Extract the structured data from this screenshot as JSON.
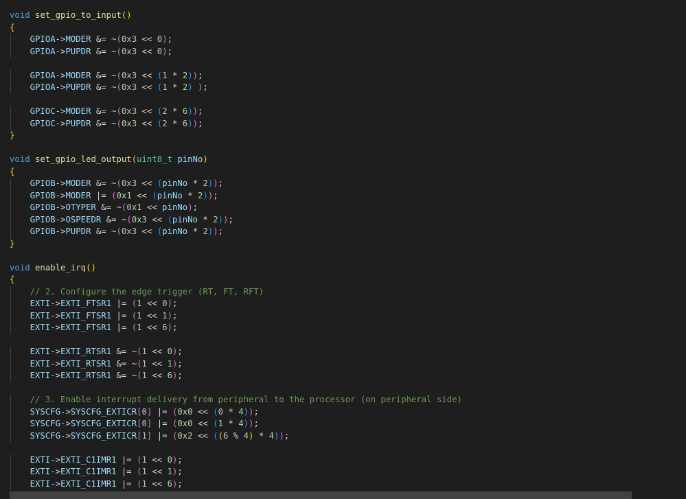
{
  "editor": {
    "lines": [
      [
        [
          "kw",
          "void"
        ],
        [
          "op",
          " "
        ],
        [
          "fn",
          "set_gpio_to_input"
        ],
        [
          "p1",
          "()"
        ]
      ],
      [
        [
          "p1",
          "{"
        ]
      ],
      [
        [
          "op",
          "    "
        ],
        [
          "var",
          "GPIOA"
        ],
        [
          "op",
          "->"
        ],
        [
          "var",
          "MODER"
        ],
        [
          "op",
          " &= ~"
        ],
        [
          "p2",
          "("
        ],
        [
          "num",
          "0x3"
        ],
        [
          "op",
          " << "
        ],
        [
          "num",
          "0"
        ],
        [
          "p2",
          ")"
        ],
        [
          "op",
          ";"
        ]
      ],
      [
        [
          "op",
          "    "
        ],
        [
          "var",
          "GPIOA"
        ],
        [
          "op",
          "->"
        ],
        [
          "var",
          "PUPDR"
        ],
        [
          "op",
          " &= ~"
        ],
        [
          "p2",
          "("
        ],
        [
          "num",
          "0x3"
        ],
        [
          "op",
          " << "
        ],
        [
          "num",
          "0"
        ],
        [
          "p2",
          ")"
        ],
        [
          "op",
          ";"
        ]
      ],
      [],
      [
        [
          "op",
          "    "
        ],
        [
          "var",
          "GPIOA"
        ],
        [
          "op",
          "->"
        ],
        [
          "var",
          "MODER"
        ],
        [
          "op",
          " &= ~"
        ],
        [
          "p2",
          "("
        ],
        [
          "num",
          "0x3"
        ],
        [
          "op",
          " << "
        ],
        [
          "p3",
          "("
        ],
        [
          "num",
          "1"
        ],
        [
          "op",
          " * "
        ],
        [
          "num",
          "2"
        ],
        [
          "p3",
          ")"
        ],
        [
          "p2",
          ")"
        ],
        [
          "op",
          ";"
        ]
      ],
      [
        [
          "op",
          "    "
        ],
        [
          "var",
          "GPIOA"
        ],
        [
          "op",
          "->"
        ],
        [
          "var",
          "PUPDR"
        ],
        [
          "op",
          " &= ~"
        ],
        [
          "p2",
          "("
        ],
        [
          "num",
          "0x3"
        ],
        [
          "op",
          " << "
        ],
        [
          "p3",
          "("
        ],
        [
          "num",
          "1"
        ],
        [
          "op",
          " * "
        ],
        [
          "num",
          "2"
        ],
        [
          "p3",
          ")"
        ],
        [
          "op",
          " "
        ],
        [
          "p2",
          ")"
        ],
        [
          "op",
          ";"
        ]
      ],
      [],
      [
        [
          "op",
          "    "
        ],
        [
          "var",
          "GPIOC"
        ],
        [
          "op",
          "->"
        ],
        [
          "var",
          "MODER"
        ],
        [
          "op",
          " &= ~"
        ],
        [
          "p2",
          "("
        ],
        [
          "num",
          "0x3"
        ],
        [
          "op",
          " << "
        ],
        [
          "p3",
          "("
        ],
        [
          "num",
          "2"
        ],
        [
          "op",
          " * "
        ],
        [
          "num",
          "6"
        ],
        [
          "p3",
          ")"
        ],
        [
          "p2",
          ")"
        ],
        [
          "op",
          ";"
        ]
      ],
      [
        [
          "op",
          "    "
        ],
        [
          "var",
          "GPIOC"
        ],
        [
          "op",
          "->"
        ],
        [
          "var",
          "PUPDR"
        ],
        [
          "op",
          " &= ~"
        ],
        [
          "p2",
          "("
        ],
        [
          "num",
          "0x3"
        ],
        [
          "op",
          " << "
        ],
        [
          "p3",
          "("
        ],
        [
          "num",
          "2"
        ],
        [
          "op",
          " * "
        ],
        [
          "num",
          "6"
        ],
        [
          "p3",
          ")"
        ],
        [
          "p2",
          ")"
        ],
        [
          "op",
          ";"
        ]
      ],
      [
        [
          "p1",
          "}"
        ]
      ],
      [],
      [
        [
          "kw",
          "void"
        ],
        [
          "op",
          " "
        ],
        [
          "fn",
          "set_gpio_led_output"
        ],
        [
          "p1",
          "("
        ],
        [
          "type",
          "uint8_t"
        ],
        [
          "op",
          " "
        ],
        [
          "var",
          "pinNo"
        ],
        [
          "p1",
          ")"
        ]
      ],
      [
        [
          "p1",
          "{"
        ]
      ],
      [
        [
          "op",
          "    "
        ],
        [
          "var",
          "GPIOB"
        ],
        [
          "op",
          "->"
        ],
        [
          "var",
          "MODER"
        ],
        [
          "op",
          " &= ~"
        ],
        [
          "p2",
          "("
        ],
        [
          "num",
          "0x3"
        ],
        [
          "op",
          " << "
        ],
        [
          "p3",
          "("
        ],
        [
          "var",
          "pinNo"
        ],
        [
          "op",
          " * "
        ],
        [
          "num",
          "2"
        ],
        [
          "p3",
          ")"
        ],
        [
          "p2",
          ")"
        ],
        [
          "op",
          ";"
        ]
      ],
      [
        [
          "op",
          "    "
        ],
        [
          "var",
          "GPIOB"
        ],
        [
          "op",
          "->"
        ],
        [
          "var",
          "MODER"
        ],
        [
          "op",
          " |= "
        ],
        [
          "p2",
          "("
        ],
        [
          "num",
          "0x1"
        ],
        [
          "op",
          " << "
        ],
        [
          "p3",
          "("
        ],
        [
          "var",
          "pinNo"
        ],
        [
          "op",
          " * "
        ],
        [
          "num",
          "2"
        ],
        [
          "p3",
          ")"
        ],
        [
          "p2",
          ")"
        ],
        [
          "op",
          ";"
        ]
      ],
      [
        [
          "op",
          "    "
        ],
        [
          "var",
          "GPIOB"
        ],
        [
          "op",
          "->"
        ],
        [
          "var",
          "OTYPER"
        ],
        [
          "op",
          " &= ~"
        ],
        [
          "p2",
          "("
        ],
        [
          "num",
          "0x1"
        ],
        [
          "op",
          " << "
        ],
        [
          "var",
          "pinNo"
        ],
        [
          "p2",
          ")"
        ],
        [
          "op",
          ";"
        ]
      ],
      [
        [
          "op",
          "    "
        ],
        [
          "var",
          "GPIOB"
        ],
        [
          "op",
          "->"
        ],
        [
          "var",
          "OSPEEDR"
        ],
        [
          "op",
          " &= ~"
        ],
        [
          "p2",
          "("
        ],
        [
          "num",
          "0x3"
        ],
        [
          "op",
          " << "
        ],
        [
          "p3",
          "("
        ],
        [
          "var",
          "pinNo"
        ],
        [
          "op",
          " * "
        ],
        [
          "num",
          "2"
        ],
        [
          "p3",
          ")"
        ],
        [
          "p2",
          ")"
        ],
        [
          "op",
          ";"
        ]
      ],
      [
        [
          "op",
          "    "
        ],
        [
          "var",
          "GPIOB"
        ],
        [
          "op",
          "->"
        ],
        [
          "var",
          "PUPDR"
        ],
        [
          "op",
          " &= ~"
        ],
        [
          "p2",
          "("
        ],
        [
          "num",
          "0x3"
        ],
        [
          "op",
          " << "
        ],
        [
          "p3",
          "("
        ],
        [
          "var",
          "pinNo"
        ],
        [
          "op",
          " * "
        ],
        [
          "num",
          "2"
        ],
        [
          "p3",
          ")"
        ],
        [
          "p2",
          ")"
        ],
        [
          "op",
          ";"
        ]
      ],
      [
        [
          "p1",
          "}"
        ]
      ],
      [],
      [
        [
          "kw",
          "void"
        ],
        [
          "op",
          " "
        ],
        [
          "fn",
          "enable_irq"
        ],
        [
          "p1",
          "()"
        ]
      ],
      [
        [
          "p1",
          "{"
        ]
      ],
      [
        [
          "op",
          "    "
        ],
        [
          "cm",
          "// 2. Configure the edge trigger (RT, FT, RFT)"
        ]
      ],
      [
        [
          "op",
          "    "
        ],
        [
          "var",
          "EXTI"
        ],
        [
          "op",
          "->"
        ],
        [
          "var",
          "EXTI_FTSR1"
        ],
        [
          "op",
          " |= "
        ],
        [
          "p2",
          "("
        ],
        [
          "num",
          "1"
        ],
        [
          "op",
          " << "
        ],
        [
          "num",
          "0"
        ],
        [
          "p2",
          ")"
        ],
        [
          "op",
          ";"
        ]
      ],
      [
        [
          "op",
          "    "
        ],
        [
          "var",
          "EXTI"
        ],
        [
          "op",
          "->"
        ],
        [
          "var",
          "EXTI_FTSR1"
        ],
        [
          "op",
          " |= "
        ],
        [
          "p2",
          "("
        ],
        [
          "num",
          "1"
        ],
        [
          "op",
          " << "
        ],
        [
          "num",
          "1"
        ],
        [
          "p2",
          ")"
        ],
        [
          "op",
          ";"
        ]
      ],
      [
        [
          "op",
          "    "
        ],
        [
          "var",
          "EXTI"
        ],
        [
          "op",
          "->"
        ],
        [
          "var",
          "EXTI_FTSR1"
        ],
        [
          "op",
          " |= "
        ],
        [
          "p2",
          "("
        ],
        [
          "num",
          "1"
        ],
        [
          "op",
          " << "
        ],
        [
          "num",
          "6"
        ],
        [
          "p2",
          ")"
        ],
        [
          "op",
          ";"
        ]
      ],
      [],
      [
        [
          "op",
          "    "
        ],
        [
          "var",
          "EXTI"
        ],
        [
          "op",
          "->"
        ],
        [
          "var",
          "EXTI_RTSR1"
        ],
        [
          "op",
          " &= ~"
        ],
        [
          "p2",
          "("
        ],
        [
          "num",
          "1"
        ],
        [
          "op",
          " << "
        ],
        [
          "num",
          "0"
        ],
        [
          "p2",
          ")"
        ],
        [
          "op",
          ";"
        ]
      ],
      [
        [
          "op",
          "    "
        ],
        [
          "var",
          "EXTI"
        ],
        [
          "op",
          "->"
        ],
        [
          "var",
          "EXTI_RTSR1"
        ],
        [
          "op",
          " &= ~"
        ],
        [
          "p2",
          "("
        ],
        [
          "num",
          "1"
        ],
        [
          "op",
          " << "
        ],
        [
          "num",
          "1"
        ],
        [
          "p2",
          ")"
        ],
        [
          "op",
          ";"
        ]
      ],
      [
        [
          "op",
          "    "
        ],
        [
          "var",
          "EXTI"
        ],
        [
          "op",
          "->"
        ],
        [
          "var",
          "EXTI_RTSR1"
        ],
        [
          "op",
          " &= ~"
        ],
        [
          "p2",
          "("
        ],
        [
          "num",
          "1"
        ],
        [
          "op",
          " << "
        ],
        [
          "num",
          "6"
        ],
        [
          "p2",
          ")"
        ],
        [
          "op",
          ";"
        ]
      ],
      [],
      [
        [
          "op",
          "    "
        ],
        [
          "cm",
          "// 3. Enable interrupt delivery from peripheral to the processor (on peripheral side)"
        ]
      ],
      [
        [
          "op",
          "    "
        ],
        [
          "var",
          "SYSCFG"
        ],
        [
          "op",
          "->"
        ],
        [
          "var",
          "SYSCFG_EXTICR"
        ],
        [
          "p2",
          "["
        ],
        [
          "num",
          "0"
        ],
        [
          "p2",
          "]"
        ],
        [
          "op",
          " |= "
        ],
        [
          "p2",
          "("
        ],
        [
          "num",
          "0x0"
        ],
        [
          "op",
          " << "
        ],
        [
          "p3",
          "("
        ],
        [
          "num",
          "0"
        ],
        [
          "op",
          " * "
        ],
        [
          "num",
          "4"
        ],
        [
          "p3",
          ")"
        ],
        [
          "p2",
          ")"
        ],
        [
          "op",
          ";"
        ]
      ],
      [
        [
          "op",
          "    "
        ],
        [
          "var",
          "SYSCFG"
        ],
        [
          "op",
          "->"
        ],
        [
          "var",
          "SYSCFG_EXTICR"
        ],
        [
          "p2",
          "["
        ],
        [
          "num",
          "0"
        ],
        [
          "p2",
          "]"
        ],
        [
          "op",
          " |= "
        ],
        [
          "p2",
          "("
        ],
        [
          "num",
          "0x0"
        ],
        [
          "op",
          " << "
        ],
        [
          "p3",
          "("
        ],
        [
          "num",
          "1"
        ],
        [
          "op",
          " * "
        ],
        [
          "num",
          "4"
        ],
        [
          "p3",
          ")"
        ],
        [
          "p2",
          ")"
        ],
        [
          "op",
          ";"
        ]
      ],
      [
        [
          "op",
          "    "
        ],
        [
          "var",
          "SYSCFG"
        ],
        [
          "op",
          "->"
        ],
        [
          "var",
          "SYSCFG_EXTICR"
        ],
        [
          "p2",
          "["
        ],
        [
          "num",
          "1"
        ],
        [
          "p2",
          "]"
        ],
        [
          "op",
          " |= "
        ],
        [
          "p2",
          "("
        ],
        [
          "num",
          "0x2"
        ],
        [
          "op",
          " << "
        ],
        [
          "p3",
          "("
        ],
        [
          "p1",
          "("
        ],
        [
          "num",
          "6"
        ],
        [
          "op",
          " % "
        ],
        [
          "num",
          "4"
        ],
        [
          "p1",
          ")"
        ],
        [
          "op",
          " * "
        ],
        [
          "num",
          "4"
        ],
        [
          "p3",
          ")"
        ],
        [
          "p2",
          ")"
        ],
        [
          "op",
          ";"
        ]
      ],
      [],
      [
        [
          "op",
          "    "
        ],
        [
          "var",
          "EXTI"
        ],
        [
          "op",
          "->"
        ],
        [
          "var",
          "EXTI_C1IMR1"
        ],
        [
          "op",
          " |= "
        ],
        [
          "p2",
          "("
        ],
        [
          "num",
          "1"
        ],
        [
          "op",
          " << "
        ],
        [
          "num",
          "0"
        ],
        [
          "p2",
          ")"
        ],
        [
          "op",
          ";"
        ]
      ],
      [
        [
          "op",
          "    "
        ],
        [
          "var",
          "EXTI"
        ],
        [
          "op",
          "->"
        ],
        [
          "var",
          "EXTI_C1IMR1"
        ],
        [
          "op",
          " |= "
        ],
        [
          "p2",
          "("
        ],
        [
          "num",
          "1"
        ],
        [
          "op",
          " << "
        ],
        [
          "num",
          "1"
        ],
        [
          "p2",
          ")"
        ],
        [
          "op",
          ";"
        ]
      ],
      [
        [
          "op",
          "    "
        ],
        [
          "var",
          "EXTI"
        ],
        [
          "op",
          "->"
        ],
        [
          "var",
          "EXTI_C1IMR1"
        ],
        [
          "op",
          " |= "
        ],
        [
          "p2",
          "("
        ],
        [
          "num",
          "1"
        ],
        [
          "op",
          " << "
        ],
        [
          "num",
          "6"
        ],
        [
          "p2",
          ")"
        ],
        [
          "op",
          ";"
        ]
      ]
    ]
  },
  "colors": {
    "background": "#1e1e1e",
    "keyword": "#569cd6",
    "function": "#dcdcaa",
    "variable": "#9cdcfe",
    "number": "#b5cea8",
    "comment": "#6a9955",
    "type": "#4ec9b0",
    "bracket_level_1": "#ffd700",
    "bracket_level_2": "#da70d6",
    "bracket_level_3": "#179fff"
  }
}
